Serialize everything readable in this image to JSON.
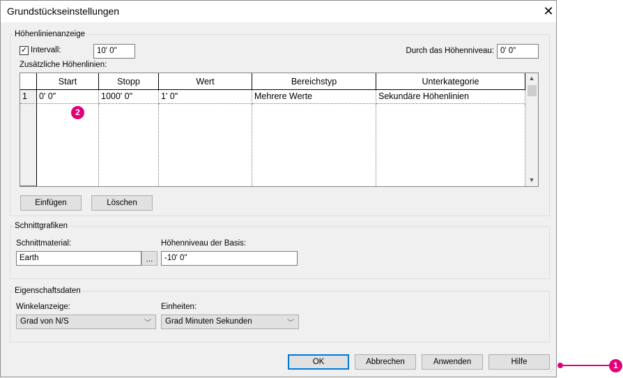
{
  "dialog": {
    "title": "Grundstückseinstellungen",
    "close_icon": "close-icon"
  },
  "contour": {
    "group_label": "Höhenlinienanzeige",
    "interval_label": "Intervall:",
    "interval_checked": true,
    "interval_value": "10'  0\"",
    "pass_label": "Durch das Höhenniveau:",
    "pass_value": "0'  0\"",
    "additional_label": "Zusätzliche Höhenlinien:",
    "columns": [
      "Start",
      "Stopp",
      "Wert",
      "Bereichstyp",
      "Unterkategorie"
    ],
    "rows": [
      {
        "num": "1",
        "cells": [
          "0'  0\"",
          "1000'  0\"",
          "1'  0\"",
          "Mehrere Werte",
          "Sekundäre Höhenlinien"
        ]
      }
    ],
    "insert_label": "Einfügen",
    "delete_label": "Löschen"
  },
  "section": {
    "group_label": "Schnittgrafiken",
    "material_label": "Schnittmaterial:",
    "material_value": "Earth",
    "browse_label": "...",
    "base_label": "Höhenniveau der Basis:",
    "base_value": "-10'  0\""
  },
  "properties": {
    "group_label": "Eigenschaftsdaten",
    "angle_label": "Winkelanzeige:",
    "angle_value": "Grad von N/S",
    "units_label": "Einheiten:",
    "units_value": "Grad Minuten Sekunden"
  },
  "footer": {
    "ok": "OK",
    "cancel": "Abbrechen",
    "apply": "Anwenden",
    "help": "Hilfe"
  },
  "annotations": {
    "badge1": "1",
    "badge2": "2",
    "color": "#e0007a"
  }
}
